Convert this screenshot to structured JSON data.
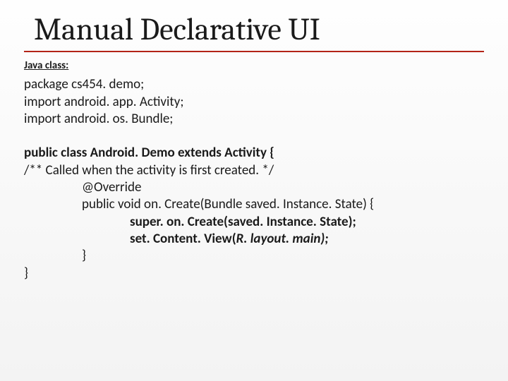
{
  "title": "Manual Declarative UI",
  "section_label": "Java class:",
  "pkg_line": "package cs454. demo;",
  "import1": "import android. app. Activity;",
  "import2": "import android. os. Bundle;",
  "class_decl": "public class Android. Demo extends Activity {",
  "comment": "/** Called when the activity is first created. */",
  "override": "@Override",
  "method_sig": "public void on. Create(Bundle saved. Instance. State) {",
  "call_super": "super. on. Create(saved. Instance. State);",
  "call_setcontent_a": "set. Content. View(",
  "call_setcontent_b": "R. layout. main);",
  "brace_inner": "}",
  "brace_outer": "}"
}
